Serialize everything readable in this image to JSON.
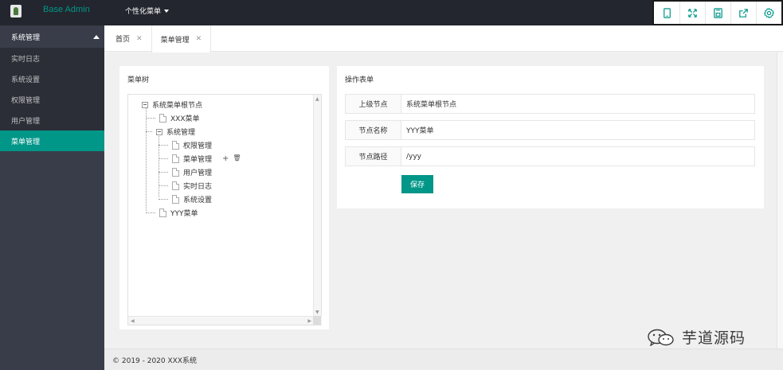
{
  "header": {
    "brand": "Base Admin",
    "top_menu": "个性化菜单",
    "tools": [
      "tablet-icon",
      "fullscreen-icon",
      "save-icon",
      "export-icon",
      "settings-icon"
    ]
  },
  "sidebar": {
    "group": "系统管理",
    "items": [
      {
        "label": "实时日志",
        "active": false
      },
      {
        "label": "系统设置",
        "active": false
      },
      {
        "label": "权限管理",
        "active": false
      },
      {
        "label": "用户管理",
        "active": false
      },
      {
        "label": "菜单管理",
        "active": true
      }
    ]
  },
  "tabs": [
    {
      "label": "首页",
      "close": "✕"
    },
    {
      "label": "菜单管理",
      "close": "✕",
      "active": true
    }
  ],
  "tree_panel": {
    "title": "菜单树",
    "nodes": {
      "root": "系统菜单根节点",
      "n1": "XXX菜单",
      "n2": "系统管理",
      "n2_1": "权限管理",
      "n2_2": "菜单管理",
      "n2_3": "用户管理",
      "n2_4": "实时日志",
      "n2_5": "系统设置",
      "n3": "YYY菜单"
    },
    "node_actions": {
      "add": "+",
      "delete": "🗑"
    }
  },
  "form_panel": {
    "title": "操作表单",
    "parent_label": "上级节点",
    "parent_value": "系统菜单根节点",
    "name_label": "节点名称",
    "name_value": "YYY菜单",
    "path_label": "节点路径",
    "path_value": "/yyy",
    "save_label": "保存"
  },
  "footer": {
    "copyright": "© 2019 - 2020 XXX系统"
  },
  "watermark": {
    "text": "芋道源码"
  },
  "colors": {
    "accent": "#009688",
    "header_bg": "#23262e",
    "sidebar_bg": "#393d49"
  }
}
